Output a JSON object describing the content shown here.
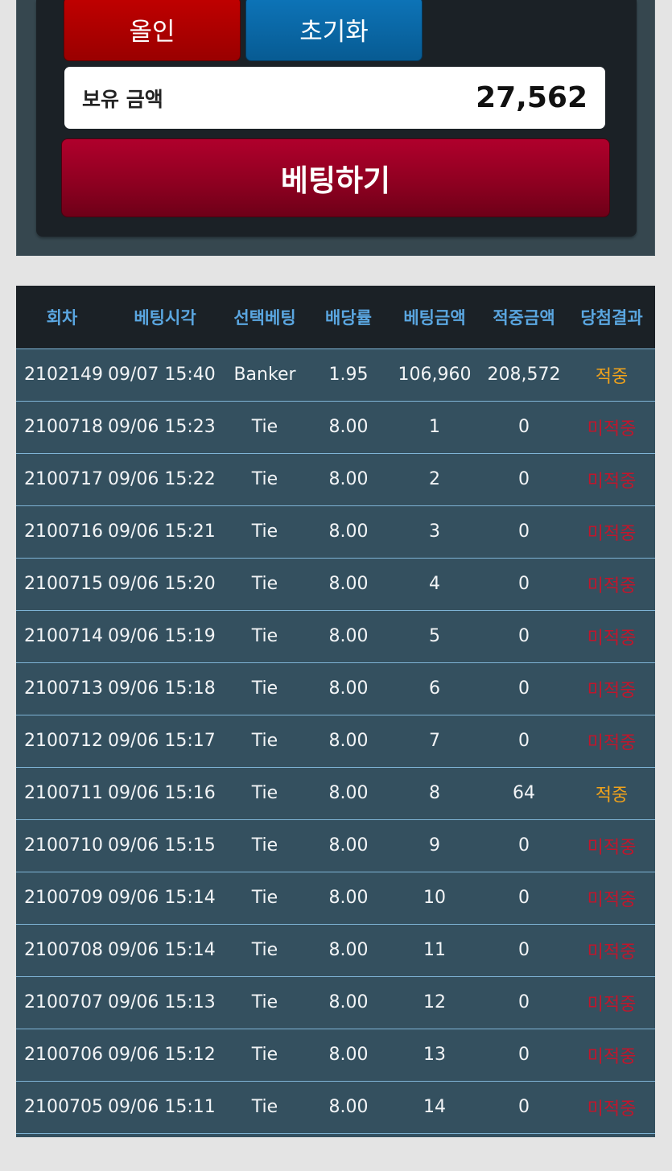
{
  "controls": {
    "allin_label": "올인",
    "reset_label": "초기화",
    "balance_label": "보유 금액",
    "balance_value": "27,562",
    "bet_label": "베팅하기"
  },
  "colors": {
    "win": "#f0a21b",
    "lose": "#c0162c",
    "header_text": "#5aa6e0",
    "row_bg": "#34505f"
  },
  "history": {
    "headers": [
      "회차",
      "베팅시각",
      "선택베팅",
      "배당률",
      "베팅금액",
      "적중금액",
      "당첨결과"
    ],
    "rows": [
      {
        "round": "2102149",
        "time": "09/07 15:40",
        "pick": "Banker",
        "odds": "1.95",
        "bet": "106,960",
        "won": "208,572",
        "result": "적중",
        "status": "win"
      },
      {
        "round": "2100718",
        "time": "09/06 15:23",
        "pick": "Tie",
        "odds": "8.00",
        "bet": "1",
        "won": "0",
        "result": "미적중",
        "status": "lose"
      },
      {
        "round": "2100717",
        "time": "09/06 15:22",
        "pick": "Tie",
        "odds": "8.00",
        "bet": "2",
        "won": "0",
        "result": "미적중",
        "status": "lose"
      },
      {
        "round": "2100716",
        "time": "09/06 15:21",
        "pick": "Tie",
        "odds": "8.00",
        "bet": "3",
        "won": "0",
        "result": "미적중",
        "status": "lose"
      },
      {
        "round": "2100715",
        "time": "09/06 15:20",
        "pick": "Tie",
        "odds": "8.00",
        "bet": "4",
        "won": "0",
        "result": "미적중",
        "status": "lose"
      },
      {
        "round": "2100714",
        "time": "09/06 15:19",
        "pick": "Tie",
        "odds": "8.00",
        "bet": "5",
        "won": "0",
        "result": "미적중",
        "status": "lose"
      },
      {
        "round": "2100713",
        "time": "09/06 15:18",
        "pick": "Tie",
        "odds": "8.00",
        "bet": "6",
        "won": "0",
        "result": "미적중",
        "status": "lose"
      },
      {
        "round": "2100712",
        "time": "09/06 15:17",
        "pick": "Tie",
        "odds": "8.00",
        "bet": "7",
        "won": "0",
        "result": "미적중",
        "status": "lose"
      },
      {
        "round": "2100711",
        "time": "09/06 15:16",
        "pick": "Tie",
        "odds": "8.00",
        "bet": "8",
        "won": "64",
        "result": "적중",
        "status": "win"
      },
      {
        "round": "2100710",
        "time": "09/06 15:15",
        "pick": "Tie",
        "odds": "8.00",
        "bet": "9",
        "won": "0",
        "result": "미적중",
        "status": "lose"
      },
      {
        "round": "2100709",
        "time": "09/06 15:14",
        "pick": "Tie",
        "odds": "8.00",
        "bet": "10",
        "won": "0",
        "result": "미적중",
        "status": "lose"
      },
      {
        "round": "2100708",
        "time": "09/06 15:14",
        "pick": "Tie",
        "odds": "8.00",
        "bet": "11",
        "won": "0",
        "result": "미적중",
        "status": "lose"
      },
      {
        "round": "2100707",
        "time": "09/06 15:13",
        "pick": "Tie",
        "odds": "8.00",
        "bet": "12",
        "won": "0",
        "result": "미적중",
        "status": "lose"
      },
      {
        "round": "2100706",
        "time": "09/06 15:12",
        "pick": "Tie",
        "odds": "8.00",
        "bet": "13",
        "won": "0",
        "result": "미적중",
        "status": "lose"
      },
      {
        "round": "2100705",
        "time": "09/06 15:11",
        "pick": "Tie",
        "odds": "8.00",
        "bet": "14",
        "won": "0",
        "result": "미적중",
        "status": "lose"
      }
    ]
  }
}
